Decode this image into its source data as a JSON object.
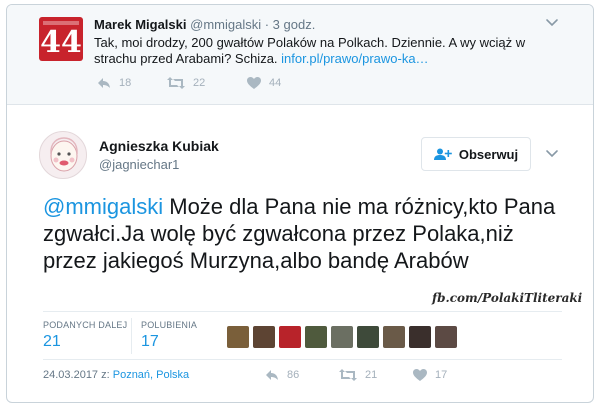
{
  "parent_tweet": {
    "avatar_text": "44",
    "name": "Marek Migalski",
    "handle": "@mmigalski",
    "separator": " · ",
    "time": "3 godz.",
    "text": "Tak, moi drodzy, 200 gwałtów Polaków na Polkach. Dziennie. A wy wciąż w strachu przed Arabami? Schiza. ",
    "link": "infor.pl/prawo/prawo-ka…",
    "replies": "18",
    "retweets": "22",
    "likes": "44"
  },
  "tweet": {
    "author_name": "Agnieszka Kubiak",
    "author_handle": "@jagniechar1",
    "follow_label": "Obserwuj",
    "mention": "@mmigalski",
    "text": " Może dla Pana nie ma różnicy,kto Pana zgwałci.Ja wolę być zgwałcona przez Polaka,niż przez jakiegoś Murzyna,albo bandę Arabów",
    "watermark": "fb.com/PolakiTliteraki",
    "retweets_label": "PODANYCH DALEJ",
    "retweets_count": "21",
    "likes_label": "POLUBIENIA",
    "likes_count": "17",
    "date": "24.03.2017 z: ",
    "place": "Poznań, Polska",
    "replies": "86",
    "retweets": "21",
    "likes": "17"
  },
  "icons": {
    "reply": "reply-icon",
    "retweet": "retweet-icon",
    "like": "heart-icon",
    "follow": "add-user-icon",
    "menu": "chevron-down-icon"
  },
  "colors": {
    "accent": "#1b95e0",
    "muted": "#657786",
    "parent_bg": "#f5f8fa",
    "avatar_red": "#c8232c"
  },
  "likers": [
    {
      "name": "liker-avatar-1",
      "color": "#7a5f3a"
    },
    {
      "name": "liker-avatar-2",
      "color": "#5d4433"
    },
    {
      "name": "liker-avatar-3",
      "color": "#b8232a"
    },
    {
      "name": "liker-avatar-4",
      "color": "#4f5a3d"
    },
    {
      "name": "liker-avatar-5",
      "color": "#6b6f62"
    },
    {
      "name": "liker-avatar-6",
      "color": "#3e4a3a"
    },
    {
      "name": "liker-avatar-7",
      "color": "#6a5a48"
    },
    {
      "name": "liker-avatar-8",
      "color": "#3a2f2c"
    },
    {
      "name": "liker-avatar-9",
      "color": "#5c4a44"
    }
  ]
}
